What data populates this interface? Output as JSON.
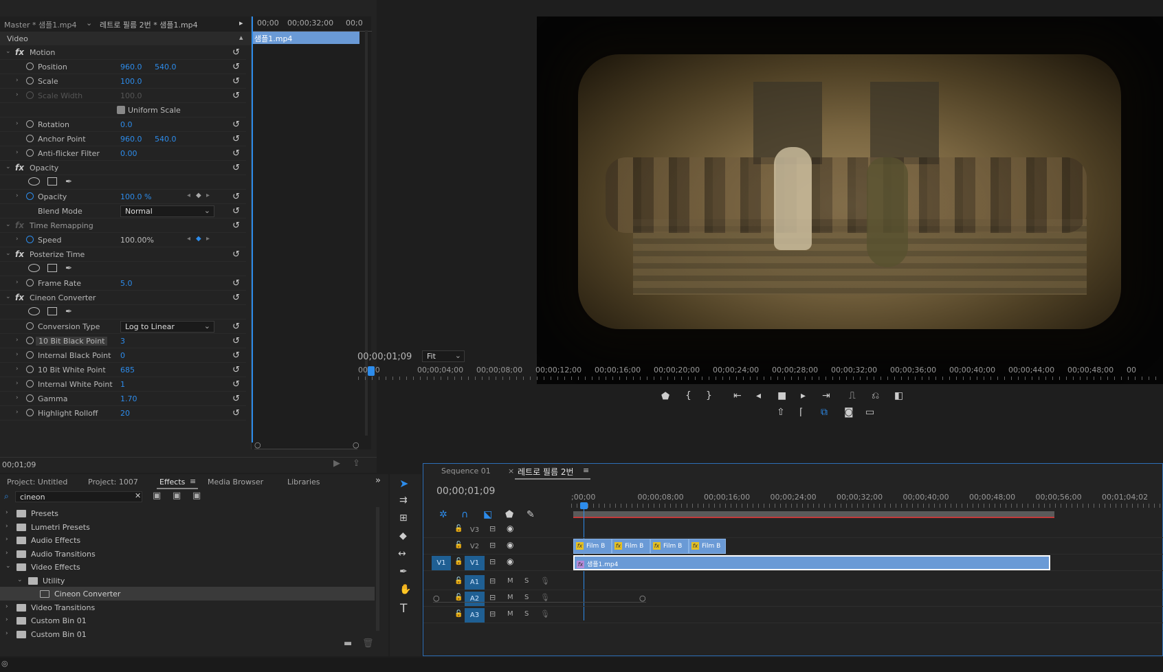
{
  "effect_controls": {
    "master_label": "Master * 샘플1.mp4",
    "sequence_clip_label": "레트로 필름 2번 * 샘플1.mp4",
    "mini_timeline_times": [
      "00;00",
      "00;00;32;00",
      "00;0"
    ],
    "mini_clip_label": "샘플1.mp4",
    "section_video": "Video",
    "rows": [
      {
        "type": "fx",
        "label": "Motion"
      },
      {
        "type": "param",
        "label": "Position",
        "v1": "960.0",
        "v2": "540.0",
        "twirl": false
      },
      {
        "type": "param",
        "label": "Scale",
        "v1": "100.0",
        "twirl": true
      },
      {
        "type": "param",
        "label": "Scale Width",
        "v1": "100.0",
        "twirl": true,
        "disabled": true
      },
      {
        "type": "check",
        "label": "Uniform Scale"
      },
      {
        "type": "param",
        "label": "Rotation",
        "v1": "0.0",
        "twirl": true
      },
      {
        "type": "param",
        "label": "Anchor Point",
        "v1": "960.0",
        "v2": "540.0",
        "twirl": false
      },
      {
        "type": "param",
        "label": "Anti-flicker Filter",
        "v1": "0.00",
        "twirl": true
      },
      {
        "type": "fx",
        "label": "Opacity"
      },
      {
        "type": "masks"
      },
      {
        "type": "param",
        "label": "Opacity",
        "v1": "100.0 %",
        "twirl": true,
        "keyframe": true
      },
      {
        "type": "dropdown",
        "label": "Blend Mode",
        "value": "Normal"
      },
      {
        "type": "fx",
        "label": "Time Remapping",
        "disabled": true
      },
      {
        "type": "param",
        "label": "Speed",
        "v1": "100.00%",
        "twirl": true,
        "keyframe": true,
        "white": true
      },
      {
        "type": "fx",
        "label": "Posterize Time"
      },
      {
        "type": "masks"
      },
      {
        "type": "param",
        "label": "Frame Rate",
        "v1": "5.0",
        "twirl": true
      },
      {
        "type": "fx",
        "label": "Cineon Converter"
      },
      {
        "type": "masks"
      },
      {
        "type": "dropdown",
        "label": "Conversion Type",
        "value": "Log to Linear"
      },
      {
        "type": "param",
        "label": "10 Bit Black Point",
        "v1": "3",
        "twirl": true,
        "selected": true
      },
      {
        "type": "param",
        "label": "Internal Black Point",
        "v1": "0",
        "twirl": true
      },
      {
        "type": "param",
        "label": "10 Bit White Point",
        "v1": "685",
        "twirl": true
      },
      {
        "type": "param",
        "label": "Internal White Point",
        "v1": "1",
        "twirl": true
      },
      {
        "type": "param",
        "label": "Gamma",
        "v1": "1.70",
        "twirl": true
      },
      {
        "type": "param",
        "label": "Highlight Rolloff",
        "v1": "20",
        "twirl": true
      }
    ],
    "timecode": "00;01;09"
  },
  "program": {
    "timecode": "00;00;01;09",
    "zoom": "Fit",
    "ruler": [
      "00;00",
      "00;00;04;00",
      "00;00;08;00",
      "00;00;12;00",
      "00;00;16;00",
      "00;00;20;00",
      "00;00;24;00",
      "00;00;28;00",
      "00;00;32;00",
      "00;00;36;00",
      "00;00;40;00",
      "00;00;44;00",
      "00;00;48;00",
      "00"
    ]
  },
  "project": {
    "tabs": [
      "Project: Untitled",
      "Project: 1007",
      "Effects",
      "Media Browser",
      "Libraries"
    ],
    "active_tab": "Effects",
    "search_value": "cineon",
    "bins": [
      {
        "label": "Presets",
        "open": false,
        "indent": 0
      },
      {
        "label": "Lumetri Presets",
        "open": false,
        "indent": 0
      },
      {
        "label": "Audio Effects",
        "open": false,
        "indent": 0
      },
      {
        "label": "Audio Transitions",
        "open": false,
        "indent": 0
      },
      {
        "label": "Video Effects",
        "open": true,
        "indent": 0
      },
      {
        "label": "Utility",
        "open": true,
        "indent": 1
      },
      {
        "label": "Cineon Converter",
        "effect": true,
        "indent": 2
      },
      {
        "label": "Video Transitions",
        "open": false,
        "indent": 0
      },
      {
        "label": "Custom Bin 01",
        "open": false,
        "indent": 0
      },
      {
        "label": "Custom Bin 01",
        "open": false,
        "indent": 0
      }
    ]
  },
  "timeline": {
    "tabs": [
      "Sequence 01",
      "레트로 필름 2번"
    ],
    "timecode": "00;00;01;09",
    "ruler": [
      ";00;00",
      "00;00;08;00",
      "00;00;16;00",
      "00;00;24;00",
      "00;00;32;00",
      "00;00;40;00",
      "00;00;48;00",
      "00;00;56;00",
      "00;01;04;02"
    ],
    "video_tracks": [
      "V3",
      "V2",
      "V1"
    ],
    "audio_tracks": [
      "A1",
      "A2",
      "A3"
    ],
    "source_patch": "V1",
    "mute": "M",
    "solo": "S",
    "v2_clips": [
      "Film B",
      "Film B",
      "Film B",
      "Film B"
    ],
    "v1_clip": "샘플1.mp4"
  }
}
